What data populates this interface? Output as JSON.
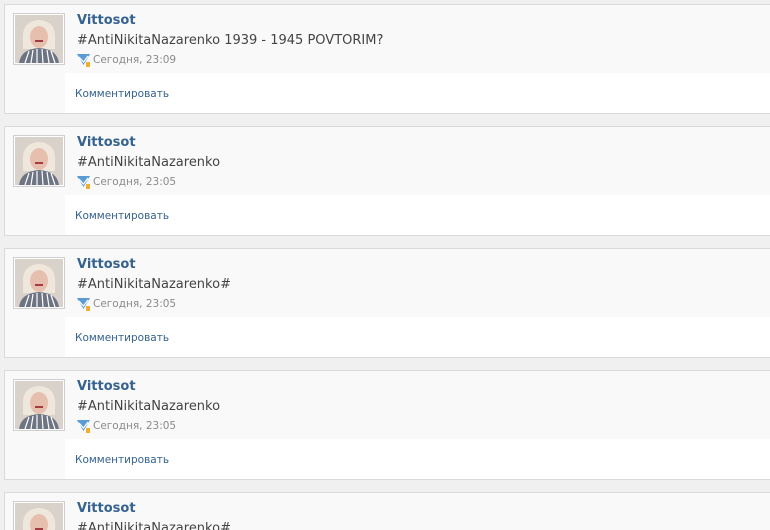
{
  "posts": [
    {
      "author": "Vittosot",
      "text": "#AntiNikitaNazarenko 1939 - 1945 POVTORIM?",
      "time": "Сегодня, 23:09",
      "comment_label": "Комментировать"
    },
    {
      "author": "Vittosot",
      "text": "#AntiNikitaNazarenko",
      "time": "Сегодня, 23:05",
      "comment_label": "Комментировать"
    },
    {
      "author": "Vittosot",
      "text": "#AntiNikitaNazarenko#",
      "time": "Сегодня, 23:05",
      "comment_label": "Комментировать"
    },
    {
      "author": "Vittosot",
      "text": "#AntiNikitaNazarenko",
      "time": "Сегодня, 23:05",
      "comment_label": "Комментировать"
    },
    {
      "author": "Vittosot",
      "text": "#AntiNikitaNazarenko#",
      "time": "",
      "comment_label": ""
    }
  ],
  "icons": {
    "avatar": "user-avatar-photo",
    "time": "mobile-check-icon"
  },
  "colors": {
    "link": "#35628f",
    "text": "#444444",
    "muted": "#8a8a8a",
    "icon": "#5b9bd5"
  }
}
